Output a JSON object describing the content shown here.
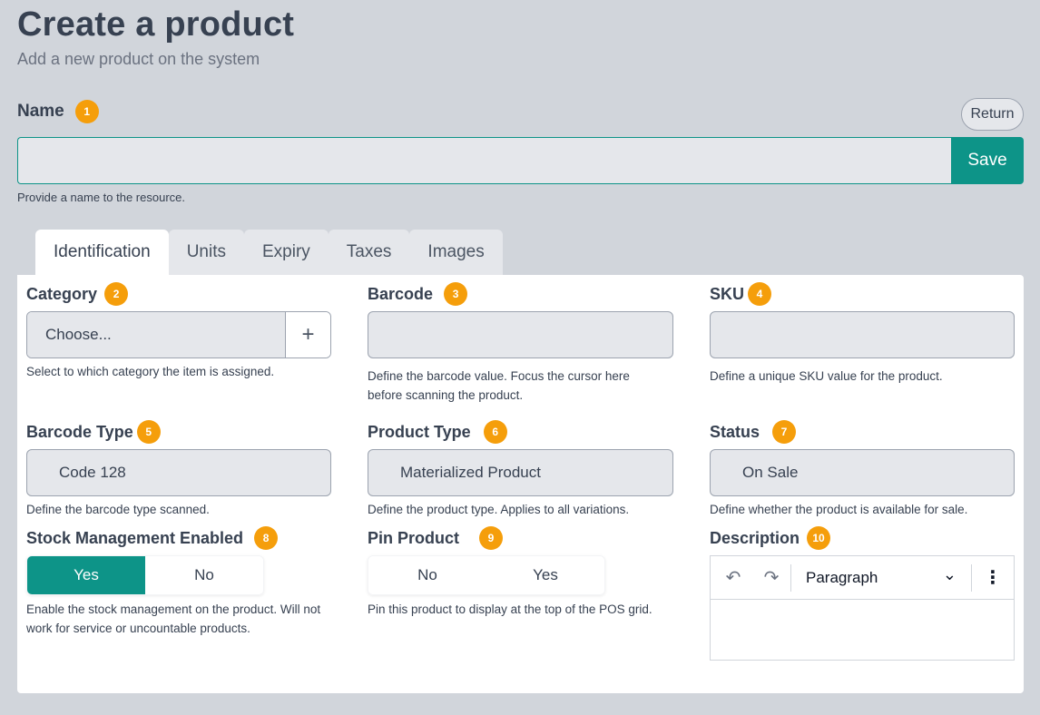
{
  "header": {
    "title": "Create a product",
    "subtitle": "Add a new product on the system"
  },
  "name_field": {
    "label": "Name",
    "badge": "1",
    "value": "",
    "help": "Provide a name to the resource.",
    "save_label": "Save",
    "return_label": "Return"
  },
  "tabs": [
    {
      "label": "Identification",
      "active": true
    },
    {
      "label": "Units",
      "active": false
    },
    {
      "label": "Expiry",
      "active": false
    },
    {
      "label": "Taxes",
      "active": false
    },
    {
      "label": "Images",
      "active": false
    }
  ],
  "fields": {
    "category": {
      "label": "Category",
      "badge": "2",
      "value": "Choose...",
      "add_icon": "+",
      "help": "Select to which category the item is assigned."
    },
    "barcode": {
      "label": "Barcode",
      "badge": "3",
      "value": "",
      "help": "Define the barcode value. Focus the cursor here before scanning the product."
    },
    "sku": {
      "label": "SKU",
      "badge": "4",
      "value": "",
      "help": "Define a unique SKU value for the product."
    },
    "barcode_type": {
      "label": "Barcode Type",
      "badge": "5",
      "value": "Code 128",
      "help": "Define the barcode type scanned."
    },
    "product_type": {
      "label": "Product Type",
      "badge": "6",
      "value": "Materialized Product",
      "help": "Define the product type. Applies to all variations."
    },
    "status": {
      "label": "Status",
      "badge": "7",
      "value": "On Sale",
      "help": "Define whether the product is available for sale."
    },
    "stock_management": {
      "label": "Stock Management Enabled",
      "badge": "8",
      "option_a": "Yes",
      "option_b": "No",
      "selected": "Yes",
      "help": "Enable the stock management on the product. Will not work for service or uncountable products."
    },
    "pin_product": {
      "label": "Pin Product",
      "badge": "9",
      "option_a": "No",
      "option_b": "Yes",
      "selected": "",
      "help": "Pin this product to display at the top of the POS grid."
    },
    "description": {
      "label": "Description",
      "badge": "10",
      "paragraph": "Paragraph",
      "undo_icon": "↶",
      "redo_icon": "↷",
      "chevron_icon": "⌄",
      "more_icon": "⋮"
    }
  },
  "colors": {
    "accent": "#0d9488",
    "badge": "#f59e0b",
    "background": "#d1d5db"
  }
}
